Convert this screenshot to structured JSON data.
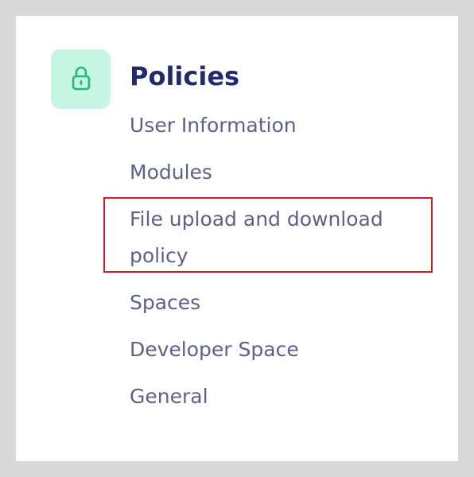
{
  "section": {
    "icon": "lock-icon",
    "icon_color": "#22b97a",
    "icon_tile_color": "#c8f6e4",
    "title": "Policies"
  },
  "nav": {
    "items": [
      {
        "label": "User Information"
      },
      {
        "label": "Modules"
      },
      {
        "label": "File upload and download policy",
        "highlighted": true
      },
      {
        "label": "Spaces"
      },
      {
        "label": "Developer Space"
      },
      {
        "label": "General"
      }
    ]
  },
  "colors": {
    "title": "#222a6b",
    "link": "#5c6285",
    "highlight_border": "#d31c24"
  }
}
